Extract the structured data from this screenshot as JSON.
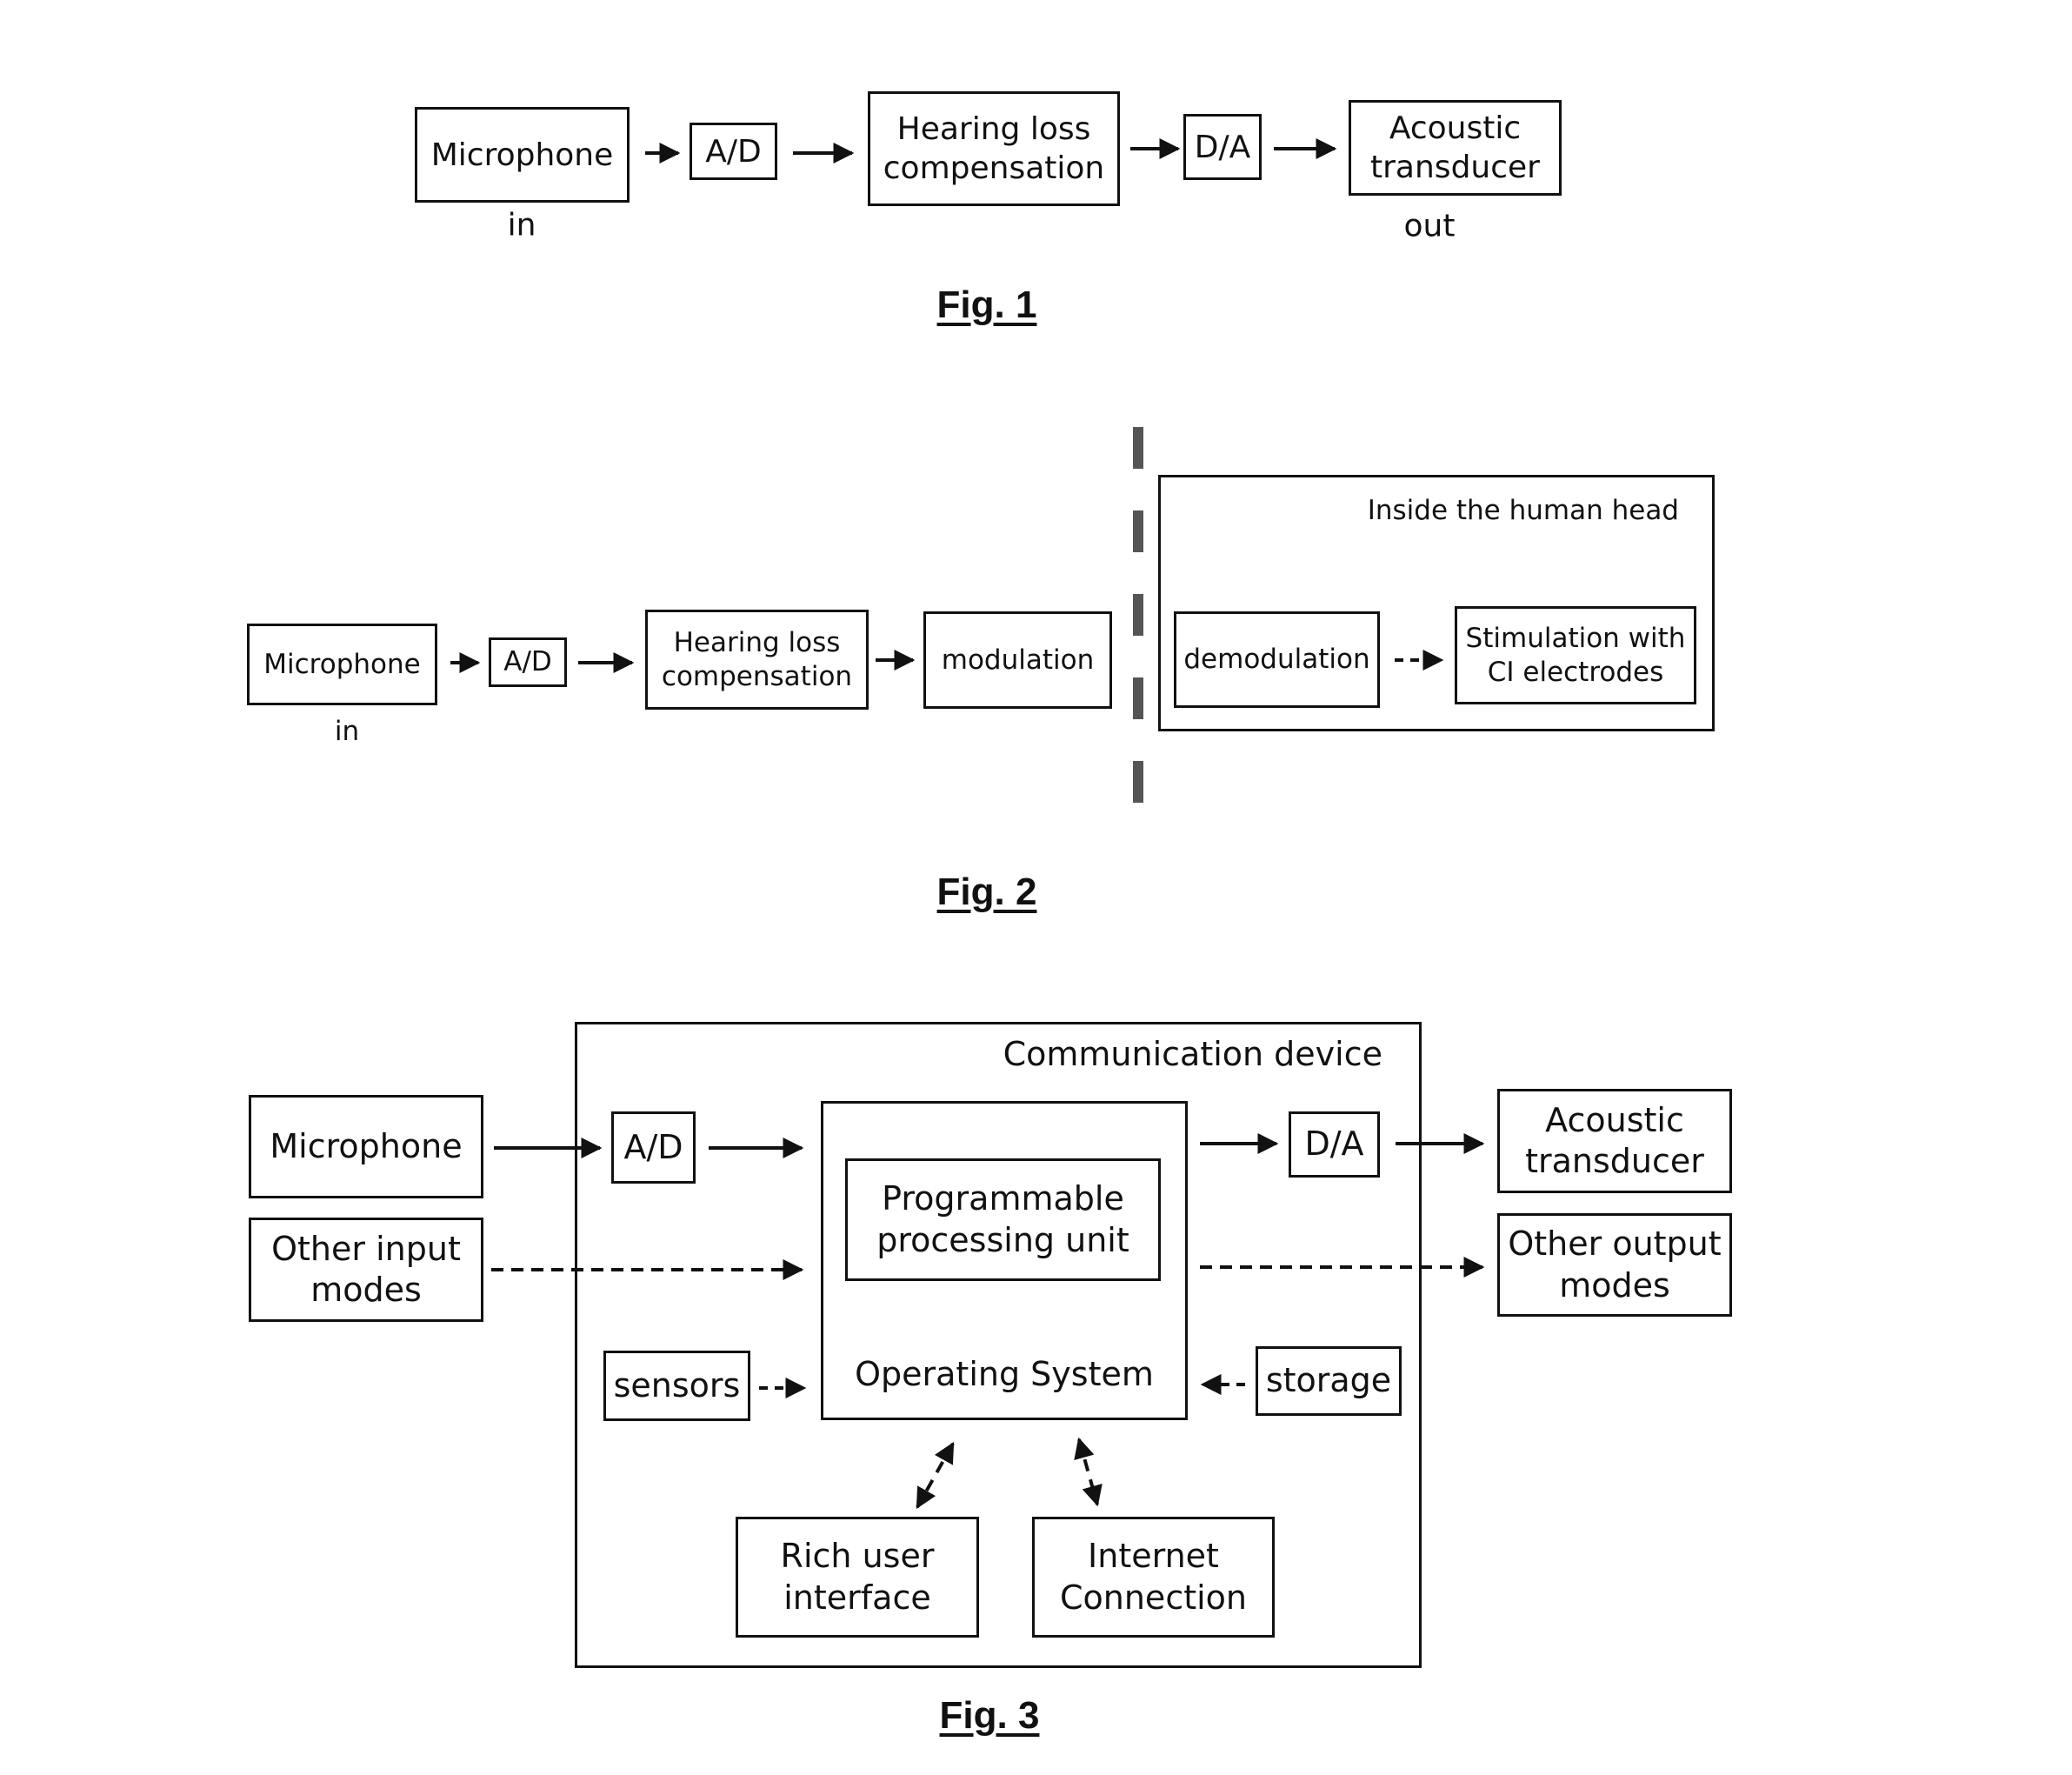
{
  "fig1": {
    "caption": "Fig. 1",
    "microphone": "Microphone",
    "ad": "A/D",
    "hlc_line1": "Hearing loss",
    "hlc_line2": "compensation",
    "da": "D/A",
    "acoustic_line1": "Acoustic",
    "acoustic_line2": "transducer",
    "in_label": "in",
    "out_label": "out"
  },
  "fig2": {
    "caption": "Fig. 2",
    "microphone": "Microphone",
    "ad": "A/D",
    "hlc_line1": "Hearing loss",
    "hlc_line2": "compensation",
    "modulation": "modulation",
    "head_title": "Inside the human head",
    "demodulation": "demodulation",
    "stim_line1": "Stimulation with",
    "stim_line2": "CI electrodes",
    "in_label": "in"
  },
  "fig3": {
    "caption": "Fig. 3",
    "device_title": "Communication device",
    "microphone": "Microphone",
    "other_input_line1": "Other input",
    "other_input_line2": "modes",
    "ad": "A/D",
    "ppu_line1": "Programmable",
    "ppu_line2": "processing unit",
    "os": "Operating System",
    "da": "D/A",
    "acoustic_line1": "Acoustic",
    "acoustic_line2": "transducer",
    "other_output_line1": "Other output",
    "other_output_line2": "modes",
    "sensors": "sensors",
    "storage": "storage",
    "rich_line1": "Rich user",
    "rich_line2": "interface",
    "internet_line1": "Internet",
    "internet_line2": "Connection"
  }
}
